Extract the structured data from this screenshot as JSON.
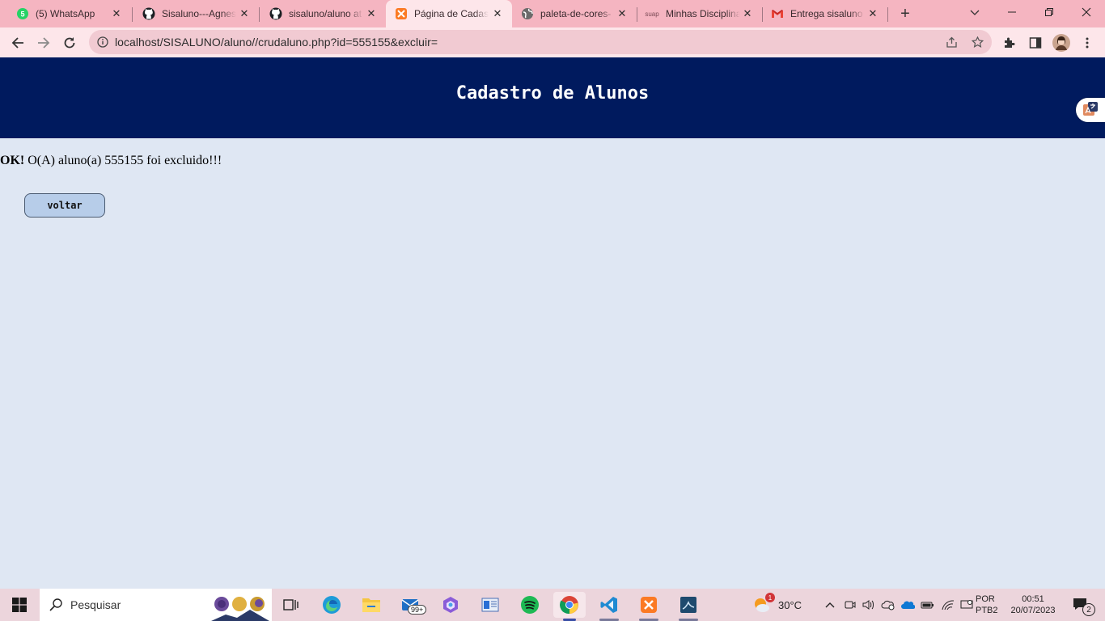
{
  "browser": {
    "tabs": [
      {
        "title": "(5) WhatsApp",
        "icon": "whatsapp-icon"
      },
      {
        "title": "Sisaluno---Agnes",
        "icon": "github-icon"
      },
      {
        "title": "sisaluno/aluno at",
        "icon": "github-icon"
      },
      {
        "title": "Página de Cadastro",
        "icon": "xampp-icon"
      },
      {
        "title": "paleta-de-cores-",
        "icon": "globe-icon"
      },
      {
        "title": "Minhas Disciplinas",
        "icon": "suap-icon",
        "favicon_text": "suap"
      },
      {
        "title": "Entrega sisaluno",
        "icon": "gmail-icon"
      }
    ],
    "active_tab_index": 3,
    "address": "localhost/SISALUNO/aluno//crudaluno.php?id=555155&excluir="
  },
  "page": {
    "title": "Cadastro de Alunos",
    "message_strong": "OK!",
    "message_text": "O(A) aluno(a) 555155 foi excluido!!!",
    "back_button": "voltar"
  },
  "taskbar": {
    "search_placeholder": "Pesquisar",
    "mail_badge": "99+",
    "weather": "30°C",
    "weather_alert": "1",
    "lang_line1": "POR",
    "lang_line2": "PTB2",
    "time": "00:51",
    "date": "20/07/2023",
    "notifications": "2"
  },
  "colors": {
    "tab_strip": "#f5b5c1",
    "header": "#001a5e",
    "page_bg": "#dfe7f3",
    "button_bg": "#b7cde9"
  }
}
